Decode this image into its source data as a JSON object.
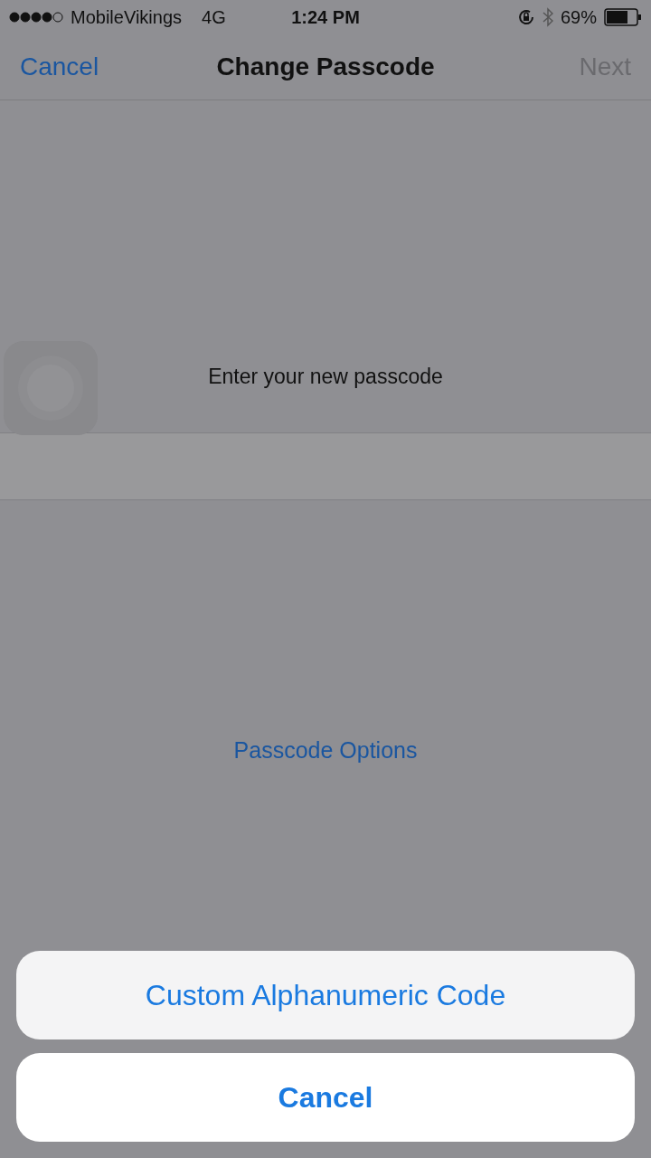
{
  "status_bar": {
    "carrier": "MobileVikings",
    "network": "4G",
    "time": "1:24 PM",
    "battery": "69%"
  },
  "nav_bar": {
    "title": "Change Passcode",
    "left_button": {
      "label": "Cancel",
      "disabled": false
    },
    "right_button": {
      "label": "Next",
      "disabled": true
    }
  },
  "prompt": "Enter your new passcode",
  "passcode_options": "Passcode Options",
  "action_sheet": {
    "actions": [
      {
        "label": "Custom Alphanumeric Code",
        "kind": "option"
      },
      {
        "label": "Cancel",
        "kind": "cancel"
      }
    ]
  }
}
